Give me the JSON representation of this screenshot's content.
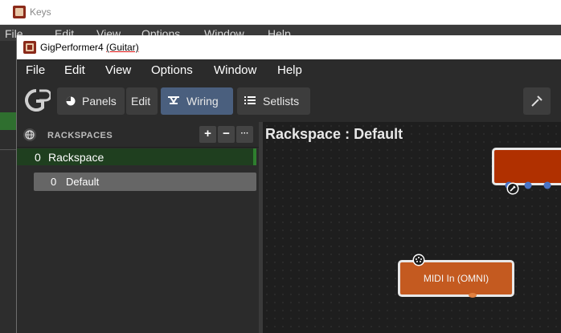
{
  "background_window": {
    "title": "Keys",
    "menu": [
      "File",
      "Edit",
      "View",
      "Options",
      "Window",
      "Help"
    ]
  },
  "window": {
    "title": "GigPerformer4",
    "title_suffix": "(Guitar)"
  },
  "menu": [
    "File",
    "Edit",
    "View",
    "Options",
    "Window",
    "Help"
  ],
  "toolbar": {
    "logo": "GP",
    "panels_label": "Panels",
    "edit_label": "Edit",
    "wiring_label": "Wiring",
    "setlists_label": "Setlists",
    "active": "Wiring"
  },
  "sidebar": {
    "title": "RACKSPACES",
    "add": "+",
    "remove": "−",
    "more": "···",
    "rackspaces": [
      {
        "index": "0",
        "name": "Rackspace",
        "variations": [
          {
            "index": "0",
            "name": "Default"
          }
        ]
      }
    ]
  },
  "canvas": {
    "title": "Rackspace : Default",
    "nodes": [
      {
        "label": "MIDI In (OMNI)",
        "color": "#c45a20"
      },
      {
        "label": "",
        "color": "#b03000"
      }
    ]
  },
  "colors": {
    "accent_active": "#4a5f7e",
    "rackspace_selected": "#1f3f1f",
    "node_midi": "#c45a20",
    "node_plugin": "#b03000"
  }
}
